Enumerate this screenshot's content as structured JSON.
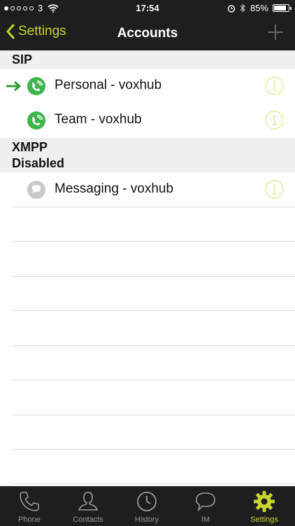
{
  "status": {
    "carrier": "3",
    "time": "17:54",
    "battery": "85%",
    "battery_level": 0.85
  },
  "nav": {
    "back_label": "Settings",
    "title": "Accounts"
  },
  "sections": [
    {
      "header": "SIP"
    },
    {
      "header_line1": "XMPP",
      "header_line2": "Disabled"
    }
  ],
  "accounts": {
    "sip": [
      {
        "label": "Personal - voxhub",
        "default": true
      },
      {
        "label": "Team - voxhub",
        "default": false
      }
    ],
    "xmpp": [
      {
        "label": "Messaging - voxhub"
      }
    ]
  },
  "tabs": [
    {
      "label": "Phone",
      "icon": "phone-icon",
      "active": false
    },
    {
      "label": "Contacts",
      "icon": "contacts-icon",
      "active": false
    },
    {
      "label": "History",
      "icon": "clock-icon",
      "active": false
    },
    {
      "label": "IM",
      "icon": "chat-bubble-icon",
      "active": false
    },
    {
      "label": "Settings",
      "icon": "gear-icon",
      "active": true
    }
  ],
  "colors": {
    "accent": "#c7d530",
    "sip_green": "#3eb54a",
    "default_arrow": "#2e9a2e",
    "bar": "#1e1e1e",
    "section_bg": "#efeff0"
  }
}
